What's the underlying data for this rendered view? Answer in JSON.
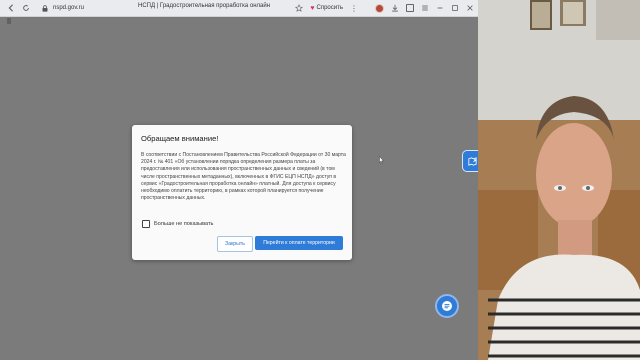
{
  "browser": {
    "url": "nspd.gov.ru",
    "page_title": "НСПД | Градостроительная проработка онлайн",
    "ask_label": "Спросить"
  },
  "modal": {
    "title": "Обращаем внимание!",
    "body": "В соответствии с Постановлением Правительства Российской Федерации от 30 марта 2024 г. № 401 «Об установлении порядка определения размера платы за предоставления или использования пространственных данных и сведений (в том числе пространственных метаданных), включенных в ФГИС ЕЦП НСПД» доступ в сервис «Градостроительная проработка онлайн» платный. Для доступа к сервису необходимо оплатить территорию, в рамках которой планируется получение пространственных данных.",
    "checkbox_label": "Больше не показывать",
    "cancel_label": "Закрыть",
    "primary_label": "Перейти к оплате территории"
  },
  "colors": {
    "accent": "#2f7bd8",
    "page_background": "#7b7b7b",
    "modal_background": "#fafafa"
  },
  "icons": {
    "back": "arrow-left-icon",
    "forward": "arrow-right-icon",
    "reload": "reload-icon",
    "lock": "lock-icon",
    "bookmark": "star-icon",
    "ask": "heart-icon",
    "menu": "more-icon",
    "side_tab": "map-icon",
    "chat": "chat-icon"
  }
}
